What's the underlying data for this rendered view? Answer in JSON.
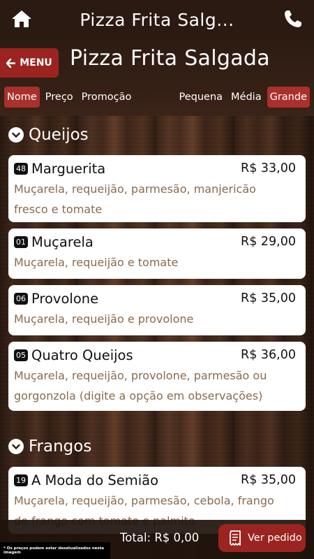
{
  "header": {
    "title": "Pizza Frita Salg...",
    "icons": {
      "home": "home-icon",
      "phone": "phone-icon"
    }
  },
  "subheader": {
    "menu_label": "MENU",
    "page_title": "Pizza Frita Salgada",
    "sort_options": [
      {
        "label": "Nome",
        "active": true
      },
      {
        "label": "Preço",
        "active": false
      },
      {
        "label": "Promoção",
        "active": false
      }
    ],
    "size_options": [
      {
        "label": "Pequena",
        "active": false
      },
      {
        "label": "Média",
        "active": false
      },
      {
        "label": "Grande",
        "active": true
      }
    ]
  },
  "sections": [
    {
      "title": "Queijos",
      "items": [
        {
          "code": "48",
          "name": "Marguerita",
          "price": "R$ 33,00",
          "desc": [
            "Muçarela, requeijão, parmesão, manjericão",
            "fresco e tomate"
          ]
        },
        {
          "code": "01",
          "name": "Muçarela",
          "price": "R$ 29,00",
          "desc": [
            "Muçarela, requeijão e tomate"
          ]
        },
        {
          "code": "06",
          "name": "Provolone",
          "price": "R$ 35,00",
          "desc": [
            "Muçarela, requeijão e provolone"
          ]
        },
        {
          "code": "05",
          "name": "Quatro Queijos",
          "price": "R$ 36,00",
          "desc": [
            "Muçarela, requeijão, provolone, parmesão ou",
            "gorgonzola (digite a opção em observações)"
          ]
        }
      ]
    },
    {
      "title": "Frangos",
      "items": [
        {
          "code": "19",
          "name": "A Moda do Semião",
          "price": "R$ 35,00",
          "desc": [
            "Muçarela, requeijão, parmesão, cebola, frango",
            "de frango com tomate e palmito"
          ]
        }
      ]
    }
  ],
  "footer": {
    "disclaimer": "* Os preços podem estar desatualizados nesta imagem",
    "total": "Total: R$ 0,00",
    "order_label": "Ver pedido"
  },
  "colors": {
    "accent": "#9b2420",
    "desc_text": "#8a6a4e",
    "header_bg": "#2b1a11"
  }
}
